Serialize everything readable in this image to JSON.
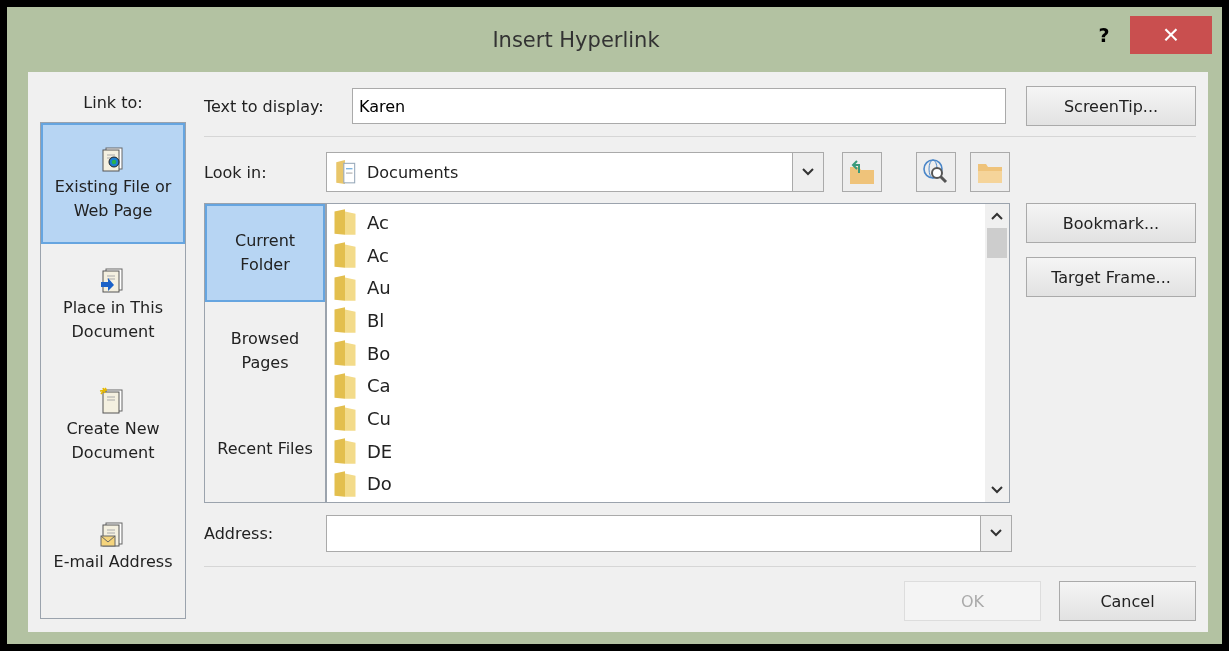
{
  "window": {
    "title": "Insert Hyperlink",
    "help": "?",
    "close": "×"
  },
  "link_to": {
    "label": "Link to:",
    "items": [
      {
        "label": "Existing File or Web Page",
        "kind": "file",
        "selected": true
      },
      {
        "label": "Place in This Document",
        "kind": "place",
        "selected": false
      },
      {
        "label": "Create New Document",
        "kind": "new",
        "selected": false
      },
      {
        "label": "E-mail Address",
        "kind": "mail",
        "selected": false
      }
    ]
  },
  "text_to_display": {
    "label": "Text to display:",
    "value": "Karen"
  },
  "screentip_button": "ScreenTip...",
  "look_in": {
    "label": "Look in:",
    "value": "Documents"
  },
  "nav": [
    {
      "label": "Current Folder",
      "selected": true
    },
    {
      "label": "Browsed Pages",
      "selected": false
    },
    {
      "label": "Recent Files",
      "selected": false
    }
  ],
  "files": [
    "Ac",
    "Ac",
    "Au",
    "Bl",
    "Bo",
    "Ca",
    "Cu",
    "DE",
    "Do"
  ],
  "side_buttons": [
    "Bookmark...",
    "Target Frame..."
  ],
  "address": {
    "label": "Address:"
  },
  "buttons": [
    {
      "label": "OK",
      "disabled": true
    },
    {
      "label": "Cancel",
      "disabled": false
    }
  ]
}
